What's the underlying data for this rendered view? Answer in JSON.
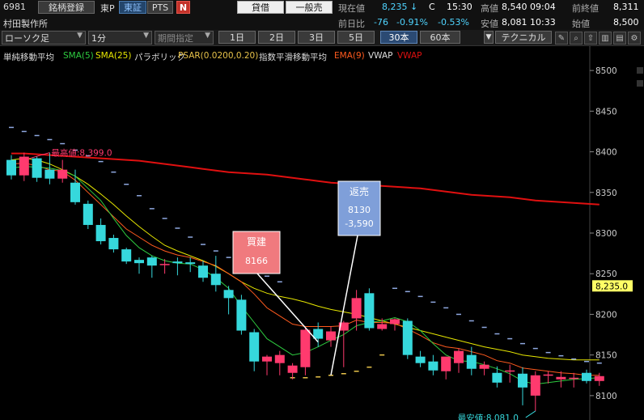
{
  "header": {
    "code": "6981",
    "register_label": "銘柄登録",
    "market_tag": "東P",
    "tse_label": "東証",
    "pts_label": "PTS",
    "n_badge": "N",
    "loan_label": "貸借",
    "general_sell_label": "一般売",
    "price_label": "現在値",
    "price_value": "8,235 ↓",
    "price_flag": "C",
    "price_time": "15:30",
    "high_label": "高値",
    "high_value": "8,540 09:04",
    "prev_close_label": "前終値",
    "prev_close_value": "8,311",
    "company": "村田製作所",
    "change_label": "前日比",
    "change_value": "-76",
    "change_pct1": "-0.91%",
    "change_pct2": "-0.53%",
    "low_label": "安値",
    "low_value": "8,081 10:33",
    "open_label": "始値",
    "open_value": "8,500"
  },
  "toolbar": {
    "chart_type": "ローソク足",
    "interval": "1分",
    "period_label": "期間指定",
    "ranges": [
      "1日",
      "2日",
      "3日",
      "5日",
      "30本",
      "60本"
    ],
    "selected_range": "30本",
    "technical_label": "テクニカル",
    "icons": [
      "pencil-icon",
      "zoom-icon",
      "export-icon",
      "bar-chart-icon",
      "table-icon",
      "gear-icon"
    ]
  },
  "indicators": {
    "sma_group": "単純移動平均",
    "sma5": "SMA(5)",
    "sma25": "SMA(25)",
    "psar_group": "パラボリック",
    "psar": "PSAR(0.0200,0.20)",
    "ema_group": "指数平滑移動平均",
    "ema9": "EMA(9)",
    "vwap_group": "VWAP",
    "vwap": "VWAP"
  },
  "colors": {
    "up": "#ff3a6e",
    "down": "#36d8dc",
    "sma5": "#2ecc40",
    "sma25": "#e6e600",
    "psar_up": "#8fa8e0",
    "psar_down": "#e8c34a",
    "ema9": "#ff5a1e",
    "vwap": "#e01010"
  },
  "chart_data": {
    "type": "candlestick",
    "ylim": [
      8070,
      8530
    ],
    "yticks": [
      8100,
      8150,
      8200,
      8250,
      8300,
      8350,
      8400,
      8450,
      8500
    ],
    "current_price_label": "8,235.0",
    "current_price": 8235,
    "high_annotation": "最高値:8,399.0",
    "high_value": 8399,
    "low_annotation": "最安値:8,081.0",
    "low_value": 8081,
    "candles": [
      [
        8390,
        8396,
        8366,
        8371
      ],
      [
        8371,
        8399,
        8364,
        8394
      ],
      [
        8392,
        8394,
        8363,
        8368
      ],
      [
        8378,
        8399,
        8360,
        8367
      ],
      [
        8367,
        8390,
        8362,
        8378
      ],
      [
        8362,
        8378,
        8335,
        8338
      ],
      [
        8336,
        8340,
        8305,
        8310
      ],
      [
        8310,
        8318,
        8286,
        8290
      ],
      [
        8294,
        8298,
        8276,
        8280
      ],
      [
        8280,
        8282,
        8262,
        8265
      ],
      [
        8267,
        8270,
        8250,
        8263
      ],
      [
        8270,
        8272,
        8245,
        8260
      ],
      [
        8262,
        8268,
        8250,
        8262
      ],
      [
        8265,
        8270,
        8248,
        8263
      ],
      [
        8264,
        8270,
        8252,
        8262
      ],
      [
        8260,
        8266,
        8240,
        8245
      ],
      [
        8250,
        8272,
        8228,
        8236
      ],
      [
        8230,
        8235,
        8200,
        8220
      ],
      [
        8218,
        8224,
        8175,
        8180
      ],
      [
        8178,
        8182,
        8130,
        8142
      ],
      [
        8142,
        8150,
        8125,
        8148
      ],
      [
        8140,
        8155,
        8125,
        8150
      ],
      [
        8128,
        8140,
        8120,
        8137
      ],
      [
        8135,
        8184,
        8125,
        8181
      ],
      [
        8182,
        8190,
        8160,
        8170
      ],
      [
        8168,
        8185,
        8160,
        8179
      ],
      [
        8180,
        8192,
        8135,
        8190
      ],
      [
        8195,
        8230,
        8180,
        8220
      ],
      [
        8226,
        8232,
        8180,
        8183
      ],
      [
        8182,
        8195,
        8180,
        8188
      ],
      [
        8188,
        8195,
        8180,
        8194
      ],
      [
        8192,
        8195,
        8145,
        8150
      ],
      [
        8148,
        8155,
        8135,
        8140
      ],
      [
        8142,
        8150,
        8125,
        8131
      ],
      [
        8130,
        8148,
        8120,
        8148
      ],
      [
        8140,
        8158,
        8128,
        8155
      ],
      [
        8150,
        8160,
        8125,
        8133
      ],
      [
        8133,
        8142,
        8125,
        8138
      ],
      [
        8128,
        8136,
        8110,
        8116
      ],
      [
        8130,
        8138,
        8116,
        8131
      ],
      [
        8127,
        8135,
        8088,
        8110
      ],
      [
        8100,
        8130,
        8081,
        8125
      ],
      [
        8125,
        8130,
        8115,
        8126
      ],
      [
        8120,
        8130,
        8110,
        8123
      ],
      [
        8121,
        8128,
        8110,
        8122
      ],
      [
        8128,
        8132,
        8115,
        8118
      ],
      [
        8118,
        8128,
        8112,
        8124
      ]
    ],
    "sma5": [
      8380,
      8382,
      8381,
      8380,
      8377,
      8370,
      8355,
      8340,
      8318,
      8297,
      8282,
      8272,
      8266,
      8263,
      8262,
      8255,
      8245,
      8232,
      8210,
      8190,
      8170,
      8160,
      8150,
      8153,
      8160,
      8168,
      8175,
      8186,
      8190,
      8192,
      8196,
      8191,
      8180,
      8164,
      8150,
      8143,
      8142,
      8138,
      8133,
      8127,
      8118,
      8114,
      8116,
      8118,
      8120,
      8121,
      8122
    ],
    "sma25": [
      8390,
      8392,
      8390,
      8385,
      8378,
      8370,
      8360,
      8348,
      8335,
      8321,
      8308,
      8296,
      8285,
      8278,
      8272,
      8266,
      8259,
      8250,
      8240,
      8232,
      8226,
      8222,
      8219,
      8215,
      8210,
      8206,
      8203,
      8200,
      8196,
      8192,
      8188,
      8184,
      8180,
      8176,
      8172,
      8168,
      8164,
      8160,
      8157,
      8154,
      8150,
      8148,
      8146,
      8145,
      8144,
      8144,
      8144
    ],
    "ema9": [
      8385,
      8386,
      8383,
      8378,
      8376,
      8365,
      8350,
      8335,
      8320,
      8305,
      8295,
      8285,
      8278,
      8273,
      8270,
      8265,
      8260,
      8250,
      8240,
      8225,
      8208,
      8198,
      8188,
      8185,
      8185,
      8185,
      8186,
      8193,
      8190,
      8190,
      8189,
      8182,
      8174,
      8165,
      8160,
      8158,
      8154,
      8150,
      8143,
      8140,
      8134,
      8132,
      8130,
      8128,
      8127,
      8125,
      8125
    ],
    "vwap": [
      8398,
      8398,
      8397,
      8396,
      8395,
      8394,
      8393,
      8392,
      8391,
      8390,
      8389,
      8387,
      8385,
      8383,
      8381,
      8379,
      8377,
      8375,
      8374,
      8373,
      8372,
      8370,
      8368,
      8366,
      8364,
      8362,
      8361,
      8360,
      8359,
      8358,
      8357,
      8356,
      8355,
      8353,
      8351,
      8349,
      8347,
      8346,
      8345,
      8344,
      8342,
      8340,
      8339,
      8338,
      8337,
      8336,
      8335
    ],
    "psar": [
      [
        8430,
        "u"
      ],
      [
        8425,
        "u"
      ],
      [
        8420,
        "u"
      ],
      [
        8415,
        "u"
      ],
      [
        8410,
        "u"
      ],
      [
        8402,
        "u"
      ],
      [
        8395,
        "u"
      ],
      [
        8388,
        "u"
      ],
      [
        8375,
        "u"
      ],
      [
        8360,
        "u"
      ],
      [
        8346,
        "u"
      ],
      [
        8330,
        "u"
      ],
      [
        8318,
        "u"
      ],
      [
        8306,
        "u"
      ],
      [
        8295,
        "u"
      ],
      [
        8286,
        "u"
      ],
      [
        8278,
        "u"
      ],
      [
        8270,
        "u"
      ],
      [
        8263,
        "u"
      ],
      [
        8255,
        "u"
      ],
      [
        8247,
        "u"
      ],
      [
        8240,
        "u"
      ],
      [
        8122,
        "d"
      ],
      [
        8122,
        "d"
      ],
      [
        8123,
        "d"
      ],
      [
        8125,
        "d"
      ],
      [
        8127,
        "d"
      ],
      [
        8130,
        "d"
      ],
      [
        8135,
        "d"
      ],
      [
        8150,
        "d"
      ],
      [
        8232,
        "u"
      ],
      [
        8228,
        "u"
      ],
      [
        8222,
        "u"
      ],
      [
        8215,
        "u"
      ],
      [
        8208,
        "u"
      ],
      [
        8200,
        "u"
      ],
      [
        8192,
        "u"
      ],
      [
        8184,
        "u"
      ],
      [
        8176,
        "u"
      ],
      [
        8170,
        "u"
      ],
      [
        8164,
        "u"
      ],
      [
        8158,
        "u"
      ],
      [
        8153,
        "u"
      ],
      [
        8149,
        "u"
      ],
      [
        8145,
        "u"
      ],
      [
        8142,
        "u"
      ],
      [
        8140,
        "u"
      ]
    ],
    "buy_marker": {
      "label": "買建",
      "price": "8166",
      "index": 24
    },
    "sell_marker": {
      "label": "返売",
      "price": "8130",
      "pnl": "-3,590",
      "index": 25
    }
  }
}
